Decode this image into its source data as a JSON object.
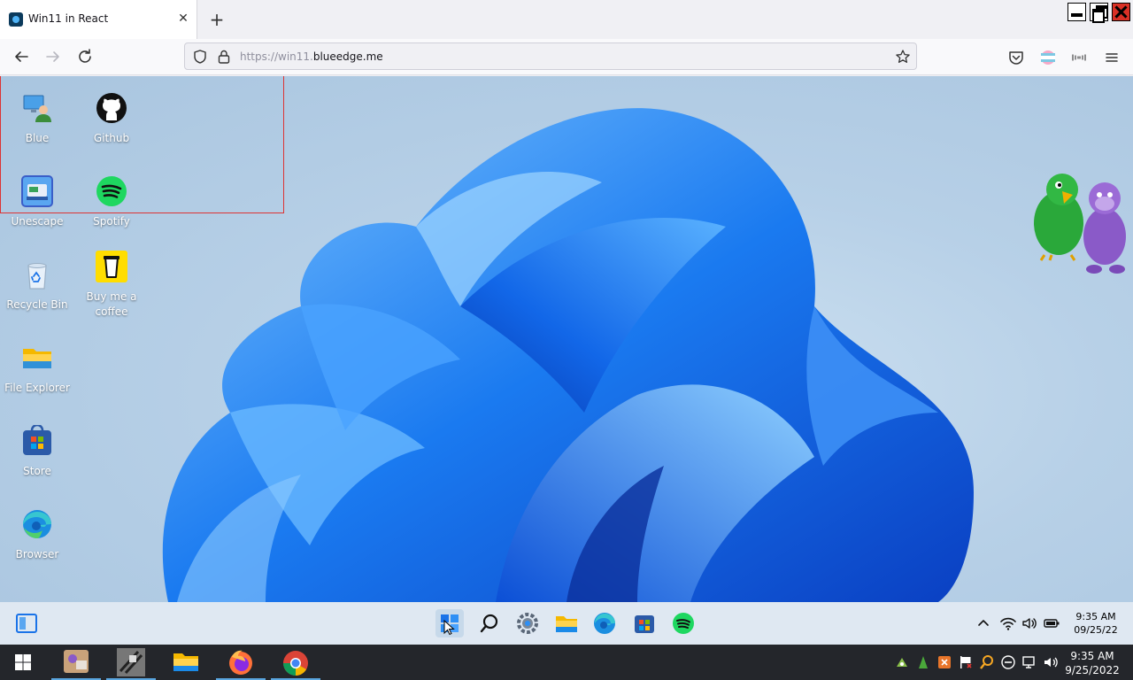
{
  "browser": {
    "tab_title": "Win11 in React",
    "tab_close": "✕",
    "new_tab": "+",
    "url_prefix": "https://win11.",
    "url_domain": "blueedge.me"
  },
  "desktop": {
    "icons": [
      {
        "label": "Blue",
        "icon": "user-computer-icon"
      },
      {
        "label": "Github",
        "icon": "github-icon"
      },
      {
        "label": "Unescape",
        "icon": "unescape-icon"
      },
      {
        "label": "Spotify",
        "icon": "spotify-icon"
      },
      {
        "label": "Recycle Bin",
        "icon": "recycle-bin-icon"
      },
      {
        "label": "Buy me a coffee",
        "icon": "coffee-icon"
      },
      {
        "label": "File Explorer",
        "icon": "folder-icon"
      },
      {
        "label": "Store",
        "icon": "store-icon"
      },
      {
        "label": "Browser",
        "icon": "edge-icon"
      }
    ]
  },
  "w11_taskbar": {
    "apps": [
      "start-icon",
      "search-icon",
      "settings-icon",
      "file-explorer-icon",
      "edge-icon",
      "store-icon",
      "spotify-icon"
    ],
    "clock_time": "9:35 AM",
    "clock_date": "09/25/22"
  },
  "host_taskbar": {
    "clock_time": "9:35 AM",
    "clock_date": "9/25/2022"
  },
  "colors": {
    "accent_blue": "#1a73e8",
    "spotify_green": "#1ed760",
    "close_red": "#d93025"
  }
}
